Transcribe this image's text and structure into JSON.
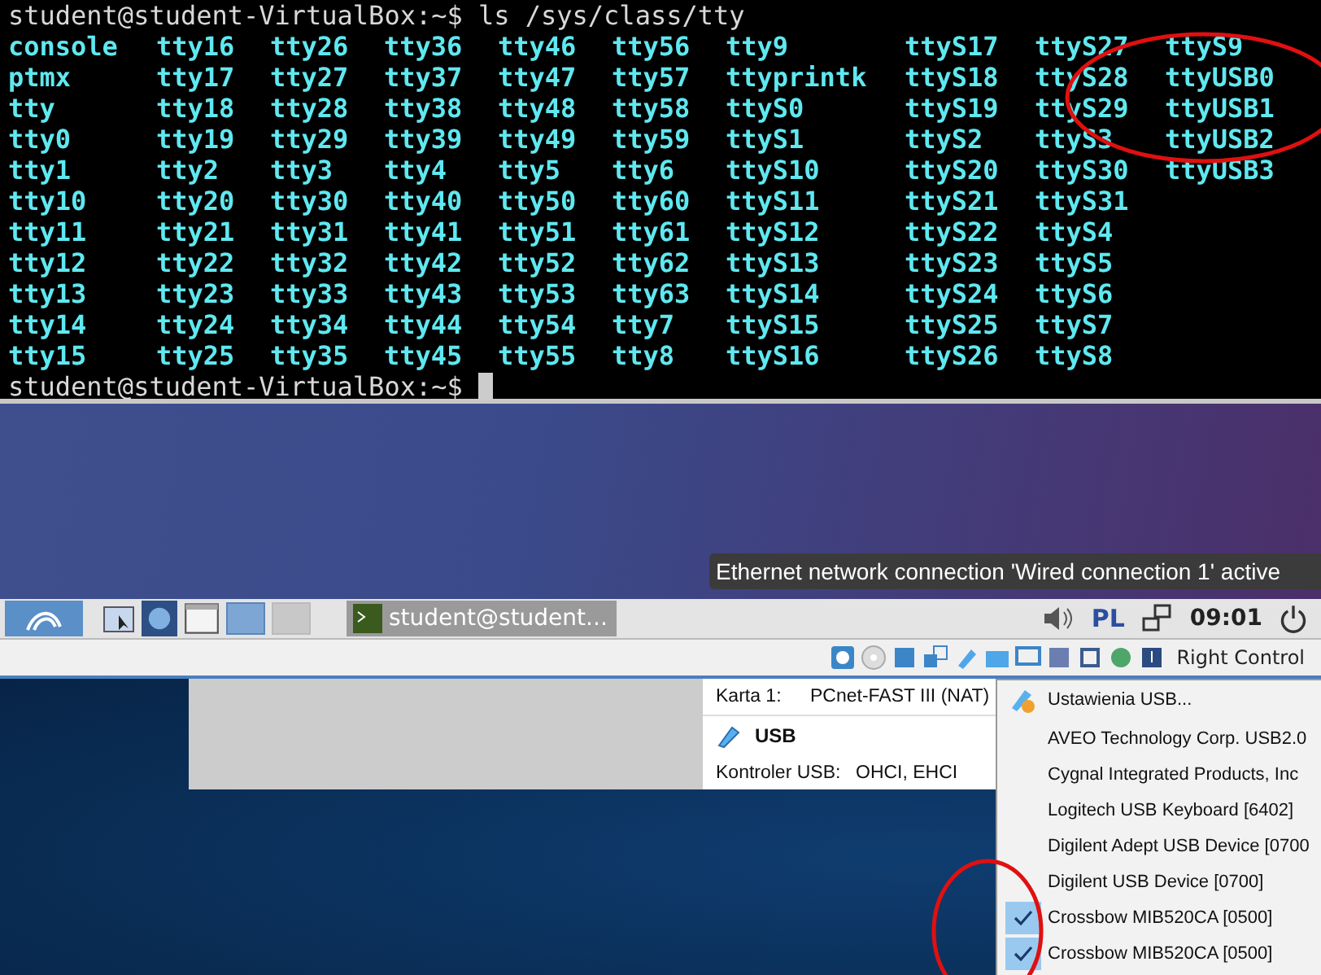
{
  "terminal": {
    "prompt": "student@student-VirtualBox:~$",
    "command": "ls /sys/class/tty",
    "rows": [
      [
        "console",
        "tty16",
        "tty26",
        "tty36",
        "tty46",
        "tty56",
        "tty9",
        "ttyS17",
        "ttyS27",
        "ttyS9"
      ],
      [
        "ptmx",
        "tty17",
        "tty27",
        "tty37",
        "tty47",
        "tty57",
        "ttyprintk",
        "ttyS18",
        "ttyS28",
        "ttyUSB0"
      ],
      [
        "tty",
        "tty18",
        "tty28",
        "tty38",
        "tty48",
        "tty58",
        "ttyS0",
        "ttyS19",
        "ttyS29",
        "ttyUSB1"
      ],
      [
        "tty0",
        "tty19",
        "tty29",
        "tty39",
        "tty49",
        "tty59",
        "ttyS1",
        "ttyS2",
        "ttyS3",
        "ttyUSB2"
      ],
      [
        "tty1",
        "tty2",
        "tty3",
        "tty4",
        "tty5",
        "tty6",
        "ttyS10",
        "ttyS20",
        "ttyS30",
        "ttyUSB3"
      ],
      [
        "tty10",
        "tty20",
        "tty30",
        "tty40",
        "tty50",
        "tty60",
        "ttyS11",
        "ttyS21",
        "ttyS31"
      ],
      [
        "tty11",
        "tty21",
        "tty31",
        "tty41",
        "tty51",
        "tty61",
        "ttyS12",
        "ttyS22",
        "ttyS4"
      ],
      [
        "tty12",
        "tty22",
        "tty32",
        "tty42",
        "tty52",
        "tty62",
        "ttyS13",
        "ttyS23",
        "ttyS5"
      ],
      [
        "tty13",
        "tty23",
        "tty33",
        "tty43",
        "tty53",
        "tty63",
        "ttyS14",
        "ttyS24",
        "ttyS6"
      ],
      [
        "tty14",
        "tty24",
        "tty34",
        "tty44",
        "tty54",
        "tty7",
        "ttyS15",
        "ttyS25",
        "ttyS7"
      ],
      [
        "tty15",
        "tty25",
        "tty35",
        "tty45",
        "tty55",
        "tty8",
        "ttyS16",
        "ttyS26",
        "ttyS8"
      ]
    ],
    "final_prompt": "student@student-VirtualBox:~$"
  },
  "notification": {
    "text": "Ethernet network connection 'Wired connection 1' active"
  },
  "taskbar": {
    "workspaces": [
      {
        "selected": true
      },
      {
        "selected": false
      }
    ],
    "task": "student@student...",
    "layout": "PL",
    "clock": "09:01"
  },
  "vm_status_bar": {
    "host_key": "Right Control"
  },
  "details": {
    "network_rows": [
      {
        "label": "Karta 1:",
        "value": "PCnet-FAST III (NAT)"
      }
    ],
    "usb_heading": "USB",
    "usb_rows": [
      {
        "label": "Kontroler USB:",
        "value": "OHCI, EHCI"
      }
    ]
  },
  "usb_menu": {
    "settings": "Ustawienia USB...",
    "devices": [
      {
        "name": "AVEO Technology Corp. USB2.0",
        "checked": false
      },
      {
        "name": "Cygnal Integrated Products, Inc",
        "checked": false
      },
      {
        "name": "Logitech USB Keyboard [6402]",
        "checked": false
      },
      {
        "name": "Digilent Adept USB Device [0700",
        "checked": false
      },
      {
        "name": "Digilent USB Device [0700]",
        "checked": false
      },
      {
        "name": "Crossbow MIB520CA [0500]",
        "checked": true
      },
      {
        "name": "Crossbow MIB520CA [0500]",
        "checked": true
      }
    ]
  }
}
